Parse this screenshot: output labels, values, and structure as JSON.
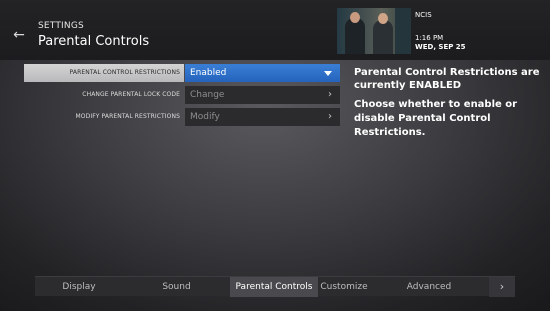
{
  "header": {
    "back_icon": "arrow-left-icon",
    "section": "SETTINGS",
    "title": "Parental Controls"
  },
  "now_playing": {
    "show": "NCIS",
    "time": "1:16 PM",
    "date": "WED, SEP 25"
  },
  "settings": {
    "rows": [
      {
        "label": "PARENTAL CONTROL RESTRICTIONS",
        "value": "Enabled",
        "selected": true,
        "icon": "caret-down-icon"
      },
      {
        "label": "CHANGE PARENTAL LOCK CODE",
        "value": "Change",
        "selected": false,
        "icon": "chevron-right-icon"
      },
      {
        "label": "MODIFY PARENTAL RESTRICTIONS",
        "value": "Modify",
        "selected": false,
        "icon": "chevron-right-icon"
      }
    ]
  },
  "info": {
    "heading": "Parental Control Restrictions are currently ENABLED",
    "description": "Choose whether to enable or disable Parental Control Restrictions."
  },
  "tabs": {
    "items": [
      {
        "label": "Display",
        "active": false
      },
      {
        "label": "Sound",
        "active": false
      },
      {
        "label": "Parental Controls",
        "active": true
      },
      {
        "label": "Customize",
        "active": false
      },
      {
        "label": "Advanced",
        "active": false
      }
    ],
    "next_icon": "chevron-right-icon"
  },
  "colors": {
    "accent": "#2f73cc",
    "selected_label_bg": "#c8c8ca",
    "control_bg": "#2b2b2e"
  }
}
